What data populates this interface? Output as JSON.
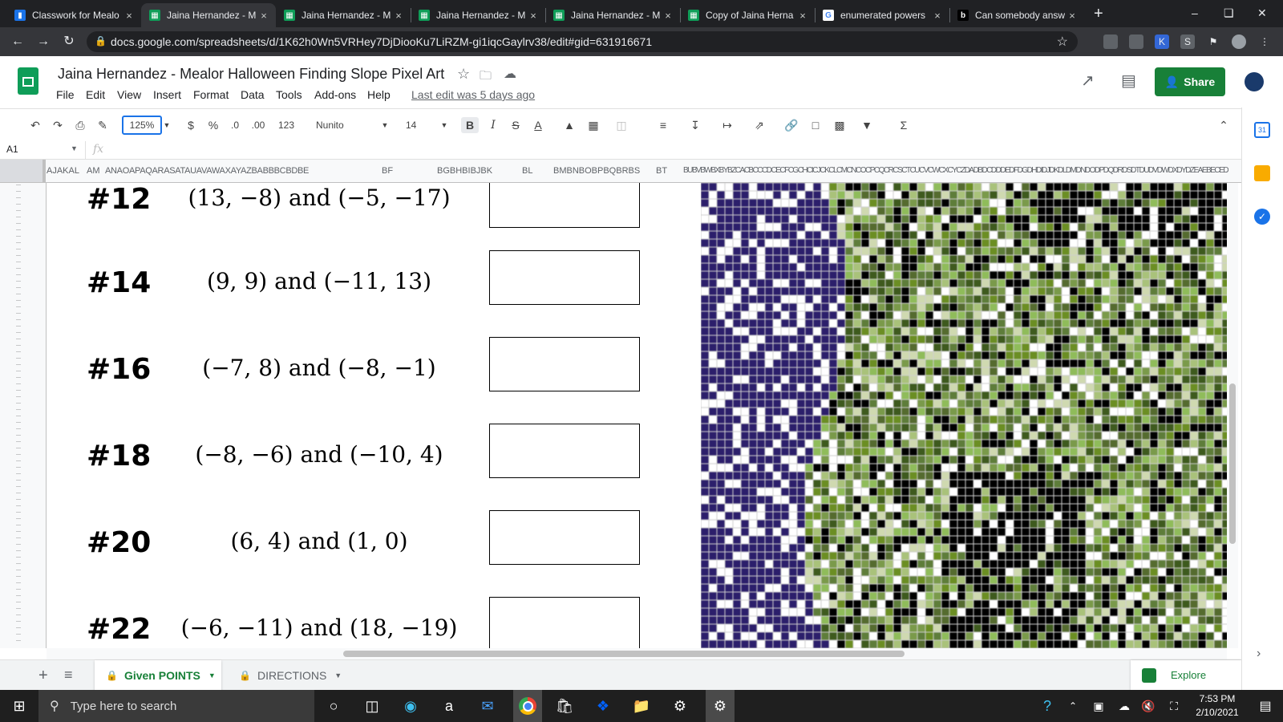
{
  "browser": {
    "tabs": [
      {
        "title": "Classwork for Mealo",
        "icon": "classroom-icon",
        "active": false
      },
      {
        "title": "Jaina Hernandez - M",
        "icon": "sheets-icon",
        "active": true
      },
      {
        "title": "Jaina Hernandez - M",
        "icon": "sheets-icon",
        "active": false
      },
      {
        "title": "Jaina Hernandez - M",
        "icon": "sheets-icon",
        "active": false
      },
      {
        "title": "Jaina Hernandez - M",
        "icon": "sheets-icon",
        "active": false
      },
      {
        "title": "Copy of Jaina Herna",
        "icon": "sheets-icon",
        "active": false
      },
      {
        "title": "enumerated powers",
        "icon": "google-icon",
        "active": false
      },
      {
        "title": "Can somebody answ",
        "icon": "brainly-icon",
        "active": false
      }
    ],
    "url": "docs.google.com/spreadsheets/d/1K62h0Wn5VRHey7DjDiooKu7LiRZM-gi1iqcGaylrv38/edit#gid=631916671"
  },
  "sheets": {
    "title": "Jaina Hernandez - Mealor Halloween Finding Slope Pixel Art",
    "menu": [
      "File",
      "Edit",
      "View",
      "Insert",
      "Format",
      "Data",
      "Tools",
      "Add-ons",
      "Help"
    ],
    "last_edit": "Last edit was 5 days ago",
    "share_label": "Share",
    "toolbar": {
      "zoom": "125%",
      "currency": "$",
      "percent": "%",
      "dec_decrease": ".0",
      "dec_increase": ".00",
      "format_more": "123",
      "font": "Nunito",
      "font_size": "14"
    },
    "name_box": "A1",
    "fx": "fx",
    "columns": [
      "AJAKAL",
      "AM",
      "ANAOAPAQARASATAUAVAWAXAYAZBABBBCBDBE",
      "BF",
      "BGBHBIBJBK",
      "BL",
      "BMBNBOBPBQBRBS",
      "BT",
      "BUBVBWBXBYBZCACBCCCDCECFCGCHCICJCKCLCMCNCOCPCQCRCSCTCUCVCWCXCYCZDADBDCDDDEDFDGDHDIDJDKDLDMDNDODPDQDRDSDTDUDVDWDXDYDZEAEBECED"
    ],
    "sheet_tabs": [
      {
        "label": "Given POINTS",
        "active": true
      },
      {
        "label": "DIRECTIONS",
        "active": false
      }
    ],
    "explore_label": "Explore"
  },
  "problems": [
    {
      "num": "#12",
      "points": "(13, −8) and (−5, −17)"
    },
    {
      "num": "#14",
      "points": "(9, 9) and (−11, 13)"
    },
    {
      "num": "#16",
      "points": "(−7, 8) and (−8, −1)"
    },
    {
      "num": "#18",
      "points": "(−8, −6) and (−10, 4)"
    },
    {
      "num": "#20",
      "points": "(6, 4) and (1, 0)"
    },
    {
      "num": "#22",
      "points": "(−6, −11) and (18, −19)"
    }
  ],
  "taskbar": {
    "search_placeholder": "Type here to search",
    "time": "7:53 PM",
    "date": "2/10/2021"
  },
  "colors": {
    "sheets_green": "#188038",
    "pixel_purple": "#2c1f6b",
    "pixel_green": "#6b8e23",
    "pixel_dark": "#000000"
  }
}
